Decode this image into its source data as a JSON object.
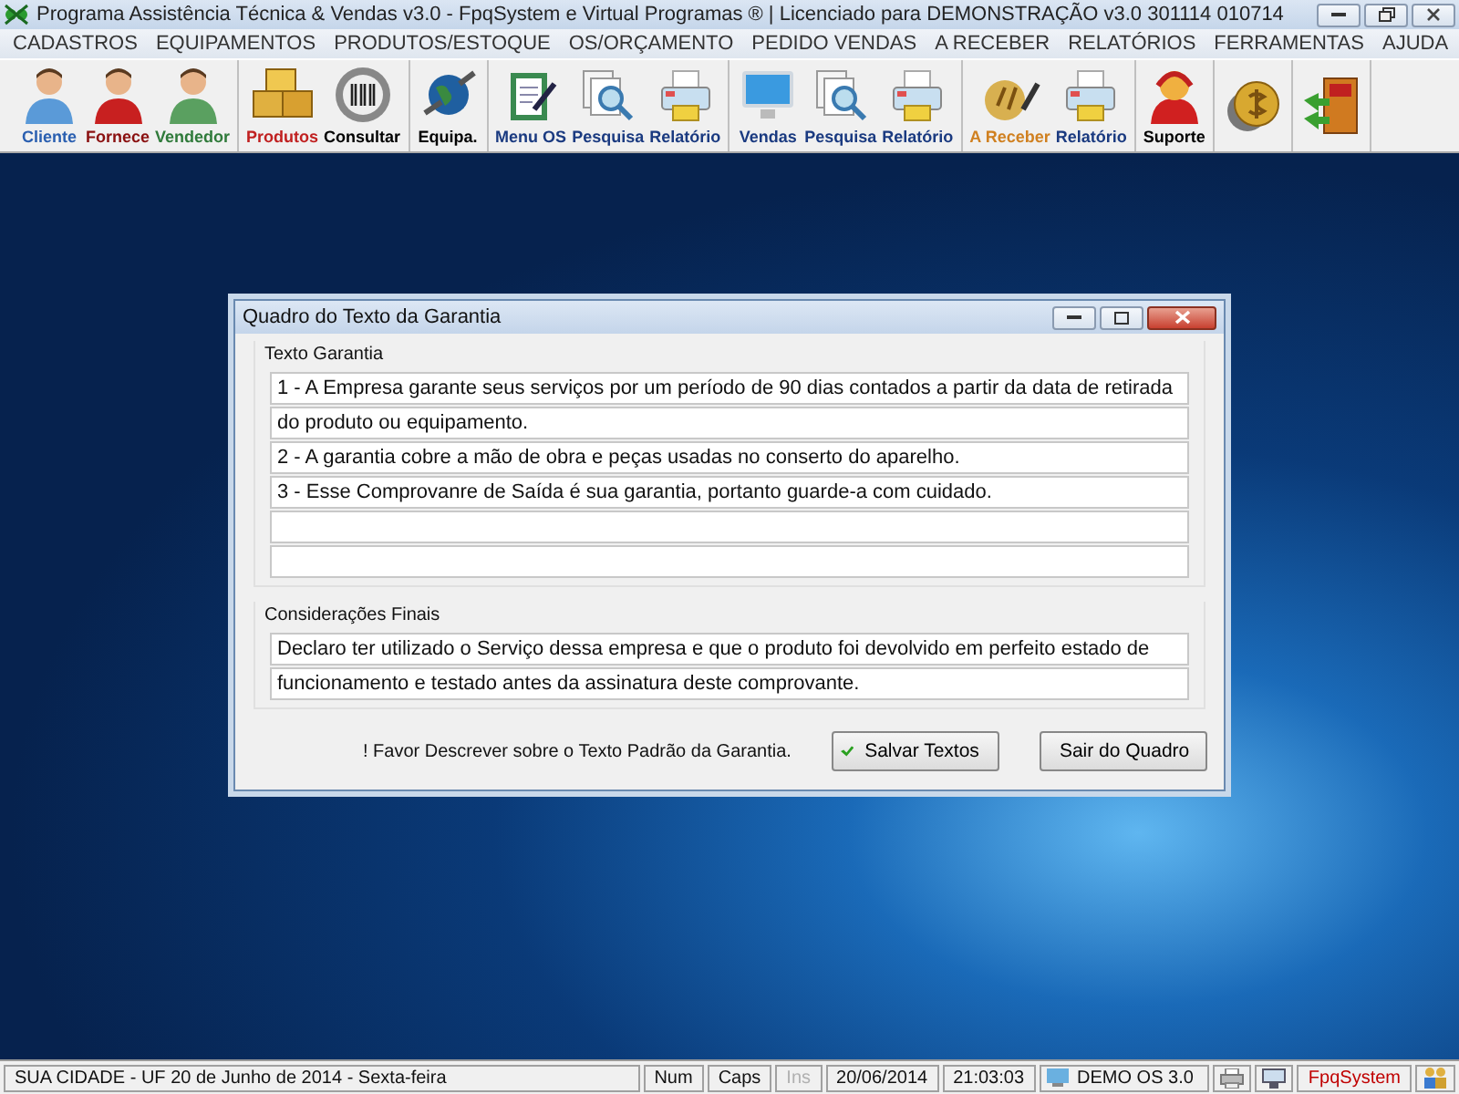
{
  "window": {
    "title": "Programa Assistência Técnica & Vendas v3.0 - FpqSystem e Virtual Programas ® | Licenciado para  DEMONSTRAÇÃO v3.0 301114 010714"
  },
  "menu": [
    "CADASTROS",
    "EQUIPAMENTOS",
    "PRODUTOS/ESTOQUE",
    "OS/ORÇAMENTO",
    "PEDIDO VENDAS",
    "A RECEBER",
    "RELATÓRIOS",
    "FERRAMENTAS",
    "AJUDA"
  ],
  "toolbar": [
    [
      {
        "kind": "person",
        "label": "Cliente",
        "color": "#2a5fb0"
      },
      {
        "kind": "person-red",
        "label": "Fornece",
        "color": "#8a1010"
      },
      {
        "kind": "person-green",
        "label": "Vendedor",
        "color": "#2f7a3a"
      }
    ],
    [
      {
        "kind": "boxes",
        "label": "Produtos",
        "color": "#c02020"
      },
      {
        "kind": "barcode",
        "label": "Consultar",
        "color": "#000000"
      }
    ],
    [
      {
        "kind": "globe",
        "label": "Equipa.",
        "color": "#000000"
      }
    ],
    [
      {
        "kind": "clipboard",
        "label": "Menu OS",
        "color": "#1a3a80"
      },
      {
        "kind": "search",
        "label": "Pesquisa",
        "color": "#1a3a80"
      },
      {
        "kind": "printer",
        "label": "Relatório",
        "color": "#1a3a80"
      }
    ],
    [
      {
        "kind": "monitor",
        "label": "Vendas",
        "color": "#1a3a80"
      },
      {
        "kind": "search",
        "label": "Pesquisa",
        "color": "#1a3a80"
      },
      {
        "kind": "printer",
        "label": "Relatório",
        "color": "#1a3a80"
      }
    ],
    [
      {
        "kind": "money",
        "label": "A Receber",
        "color": "#d08020"
      },
      {
        "kind": "printer",
        "label": "Relatório",
        "color": "#1a3a80"
      }
    ],
    [
      {
        "kind": "support",
        "label": "Suporte",
        "color": "#000000"
      }
    ],
    [
      {
        "kind": "coin"
      }
    ],
    [
      {
        "kind": "exit"
      }
    ]
  ],
  "dialog": {
    "title": "Quadro do Texto da Garantia",
    "groups": [
      {
        "label": "Texto Garantia",
        "lines": [
          {
            "kind": "text",
            "text": "1 - A Empresa garante seus serviços por um período de 90 dias contados a partir da data de retirada"
          },
          {
            "kind": "text",
            "text": "do produto ou equipamento."
          },
          {
            "kind": "text",
            "text": "2 - A garantia cobre a mão de obra e peças usadas no conserto do aparelho."
          },
          {
            "kind": "text",
            "text": "3 - Esse Comprovanre de Saída é sua garantia, portanto guarde-a com cuidado."
          },
          {
            "kind": "blank"
          },
          {
            "kind": "blank"
          }
        ]
      },
      {
        "label": "Considerações Finais",
        "lines": [
          {
            "kind": "text",
            "text": "Declaro ter utilizado o Serviço dessa empresa e que o produto foi devolvido em perfeito estado de"
          },
          {
            "kind": "text",
            "text": "funcionamento e testado antes da assinatura deste comprovante."
          }
        ]
      }
    ],
    "hint": "! Favor Descrever sobre o Texto Padrão da Garantia.",
    "buttons": [
      {
        "kind": "save",
        "label": "Salvar Textos"
      },
      {
        "kind": "exit",
        "label": "Sair do Quadro"
      }
    ]
  },
  "status_bar": [
    {
      "kind": "text",
      "text": "SUA CIDADE - UF 20 de Junho de 2014 - Sexta-feira",
      "disabled": false
    },
    {
      "kind": "text",
      "text": "Num",
      "disabled": false
    },
    {
      "kind": "text",
      "text": "Caps",
      "disabled": false
    },
    {
      "kind": "text",
      "text": "Ins",
      "disabled": true
    },
    {
      "kind": "text",
      "text": "20/06/2014",
      "disabled": false
    },
    {
      "kind": "text",
      "text": "21:03:03",
      "disabled": false
    },
    {
      "kind": "icon-text",
      "text": "DEMO OS 3.0",
      "disabled": false
    },
    {
      "kind": "printer-icon"
    },
    {
      "kind": "monitor-icon"
    },
    {
      "kind": "text",
      "text": "FpqSystem",
      "disabled": false,
      "color": "#c00000"
    },
    {
      "kind": "users-icon"
    }
  ]
}
